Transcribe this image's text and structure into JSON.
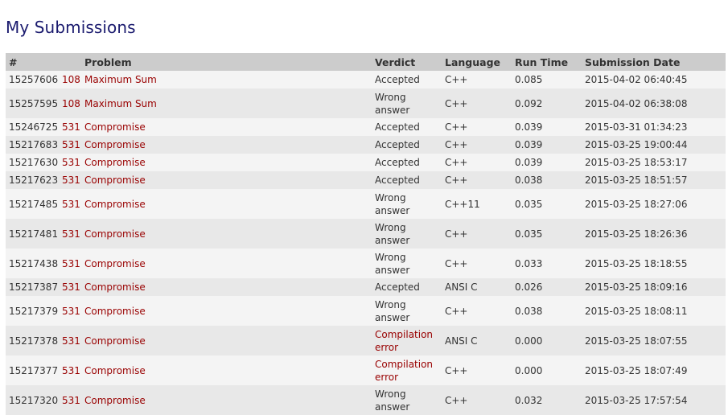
{
  "page": {
    "title": "My Submissions"
  },
  "table": {
    "headers": [
      "#",
      "",
      "Problem",
      "Verdict",
      "Language",
      "Run Time",
      "Submission Date"
    ],
    "rows": [
      {
        "id": "15257606",
        "num": "108",
        "problem": "Maximum Sum",
        "verdict": "Accepted",
        "language": "C++",
        "runtime": "0.085",
        "date": "2015-04-02 06:40:45"
      },
      {
        "id": "15257595",
        "num": "108",
        "problem": "Maximum Sum",
        "verdict": "Wrong answer",
        "language": "C++",
        "runtime": "0.092",
        "date": "2015-04-02 06:38:08"
      },
      {
        "id": "15246725",
        "num": "531",
        "problem": "Compromise",
        "verdict": "Accepted",
        "language": "C++",
        "runtime": "0.039",
        "date": "2015-03-31 01:34:23"
      },
      {
        "id": "15217683",
        "num": "531",
        "problem": "Compromise",
        "verdict": "Accepted",
        "language": "C++",
        "runtime": "0.039",
        "date": "2015-03-25 19:00:44"
      },
      {
        "id": "15217630",
        "num": "531",
        "problem": "Compromise",
        "verdict": "Accepted",
        "language": "C++",
        "runtime": "0.039",
        "date": "2015-03-25 18:53:17"
      },
      {
        "id": "15217623",
        "num": "531",
        "problem": "Compromise",
        "verdict": "Accepted",
        "language": "C++",
        "runtime": "0.038",
        "date": "2015-03-25 18:51:57"
      },
      {
        "id": "15217485",
        "num": "531",
        "problem": "Compromise",
        "verdict": "Wrong answer",
        "language": "C++11",
        "runtime": "0.035",
        "date": "2015-03-25 18:27:06"
      },
      {
        "id": "15217481",
        "num": "531",
        "problem": "Compromise",
        "verdict": "Wrong answer",
        "language": "C++",
        "runtime": "0.035",
        "date": "2015-03-25 18:26:36"
      },
      {
        "id": "15217438",
        "num": "531",
        "problem": "Compromise",
        "verdict": "Wrong answer",
        "language": "C++",
        "runtime": "0.033",
        "date": "2015-03-25 18:18:55"
      },
      {
        "id": "15217387",
        "num": "531",
        "problem": "Compromise",
        "verdict": "Accepted",
        "language": "ANSI C",
        "runtime": "0.026",
        "date": "2015-03-25 18:09:16"
      },
      {
        "id": "15217379",
        "num": "531",
        "problem": "Compromise",
        "verdict": "Wrong answer",
        "language": "C++",
        "runtime": "0.038",
        "date": "2015-03-25 18:08:11"
      },
      {
        "id": "15217378",
        "num": "531",
        "problem": "Compromise",
        "verdict": "Compilation error",
        "language": "ANSI C",
        "runtime": "0.000",
        "date": "2015-03-25 18:07:55"
      },
      {
        "id": "15217377",
        "num": "531",
        "problem": "Compromise",
        "verdict": "Compilation error",
        "language": "C++",
        "runtime": "0.000",
        "date": "2015-03-25 18:07:49"
      },
      {
        "id": "15217320",
        "num": "531",
        "problem": "Compromise",
        "verdict": "Wrong answer",
        "language": "C++",
        "runtime": "0.032",
        "date": "2015-03-25 17:57:54"
      }
    ]
  },
  "colors": {
    "title": "#1a1a6e",
    "link": "#990000",
    "header_bg": "#cccccc",
    "row_odd": "#f4f4f4",
    "row_even": "#e8e8e8"
  }
}
